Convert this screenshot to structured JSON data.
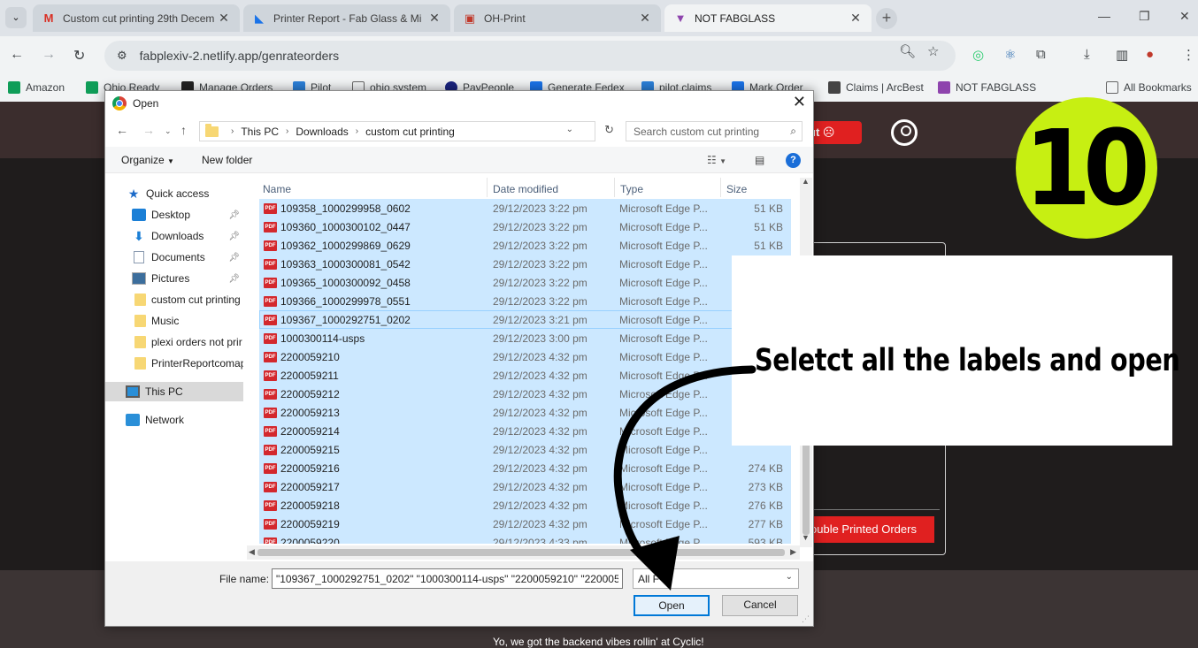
{
  "browser": {
    "tabs": [
      {
        "title": "Custom cut printing 29th Decem",
        "favicon": "gmail-icon",
        "active": false
      },
      {
        "title": "Printer Report - Fab Glass & Mi",
        "favicon": "app-icon",
        "active": false
      },
      {
        "title": "OH-Print",
        "favicon": "page-icon",
        "active": false
      },
      {
        "title": "NOT FABGLASS",
        "favicon": "vite-icon",
        "active": true
      }
    ],
    "url": "fabplexiv-2.netlify.app/genrateorders",
    "bookmarks": [
      {
        "label": "Amazon",
        "icon": "green-plus-icon"
      },
      {
        "label": "Ohio Ready",
        "icon": "green-plus-icon"
      },
      {
        "label": "Manage Orders",
        "icon": "amazon-icon"
      },
      {
        "label": "Pilot",
        "icon": "pilot-icon"
      },
      {
        "label": "ohio system",
        "icon": "page-icon"
      },
      {
        "label": "PayPeople",
        "icon": "paypeople-icon"
      },
      {
        "label": "Generate Fedex",
        "icon": "app-icon"
      },
      {
        "label": "pilot claims",
        "icon": "pilot-icon"
      },
      {
        "label": "Mark Order",
        "icon": "app-icon"
      },
      {
        "label": "Claims | ArcBest",
        "icon": "arcbest-icon"
      },
      {
        "label": "NOT FABGLASS",
        "icon": "vite-icon"
      }
    ],
    "all_bookmarks": "All Bookmarks"
  },
  "page": {
    "logout_fragment": "ut",
    "double_printed_button": "ouble Printed Orders",
    "footer_text": "Yo, we got the backend vibes rollin' at Cyclic!"
  },
  "dialog": {
    "title": "Open",
    "breadcrumb": [
      "This PC",
      "Downloads",
      "custom cut printing"
    ],
    "search_placeholder": "Search custom cut printing",
    "organize_label": "Organize",
    "new_folder_label": "New folder",
    "nav": [
      {
        "label": "Quick access",
        "icon": "star-icon",
        "pinned": false
      },
      {
        "label": "Desktop",
        "icon": "desktop-icon",
        "pinned": true
      },
      {
        "label": "Downloads",
        "icon": "download-icon",
        "pinned": true
      },
      {
        "label": "Documents",
        "icon": "documents-icon",
        "pinned": true
      },
      {
        "label": "Pictures",
        "icon": "pictures-icon",
        "pinned": true
      },
      {
        "label": "custom cut printing",
        "icon": "folder-icon",
        "pinned": false
      },
      {
        "label": "Music",
        "icon": "folder-icon",
        "pinned": false
      },
      {
        "label": "plexi orders not prir",
        "icon": "folder-icon",
        "pinned": false
      },
      {
        "label": "PrinterReportcomap",
        "icon": "folder-icon",
        "pinned": false
      },
      {
        "label": "This PC",
        "icon": "pc-icon",
        "pinned": false
      },
      {
        "label": "Network",
        "icon": "network-icon",
        "pinned": false
      }
    ],
    "columns": {
      "name": "Name",
      "date": "Date modified",
      "type": "Type",
      "size": "Size"
    },
    "files": [
      {
        "name": "109358_1000299958_0602",
        "date": "29/12/2023 3:22 pm",
        "type": "Microsoft Edge P...",
        "size": "51 KB"
      },
      {
        "name": "109360_1000300102_0447",
        "date": "29/12/2023 3:22 pm",
        "type": "Microsoft Edge P...",
        "size": "51 KB"
      },
      {
        "name": "109362_1000299869_0629",
        "date": "29/12/2023 3:22 pm",
        "type": "Microsoft Edge P...",
        "size": "51 KB"
      },
      {
        "name": "109363_1000300081_0542",
        "date": "29/12/2023 3:22 pm",
        "type": "Microsoft Edge P...",
        "size": "51 KB"
      },
      {
        "name": "109365_1000300092_0458",
        "date": "29/12/2023 3:22 pm",
        "type": "Microsoft Edge P...",
        "size": ""
      },
      {
        "name": "109366_1000299978_0551",
        "date": "29/12/2023 3:22 pm",
        "type": "Microsoft Edge P...",
        "size": ""
      },
      {
        "name": "109367_1000292751_0202",
        "date": "29/12/2023 3:21 pm",
        "type": "Microsoft Edge P...",
        "size": ""
      },
      {
        "name": "1000300114-usps",
        "date": "29/12/2023 3:00 pm",
        "type": "Microsoft Edge P...",
        "size": ""
      },
      {
        "name": "2200059210",
        "date": "29/12/2023 4:32 pm",
        "type": "Microsoft Edge P...",
        "size": ""
      },
      {
        "name": "2200059211",
        "date": "29/12/2023 4:32 pm",
        "type": "Microsoft Edge P...",
        "size": ""
      },
      {
        "name": "2200059212",
        "date": "29/12/2023 4:32 pm",
        "type": "Microsoft Edge P...",
        "size": ""
      },
      {
        "name": "2200059213",
        "date": "29/12/2023 4:32 pm",
        "type": "Microsoft Edge P...",
        "size": ""
      },
      {
        "name": "2200059214",
        "date": "29/12/2023 4:32 pm",
        "type": "Microsoft Edge P...",
        "size": ""
      },
      {
        "name": "2200059215",
        "date": "29/12/2023 4:32 pm",
        "type": "Microsoft Edge P...",
        "size": ""
      },
      {
        "name": "2200059216",
        "date": "29/12/2023 4:32 pm",
        "type": "Microsoft Edge P...",
        "size": "274 KB"
      },
      {
        "name": "2200059217",
        "date": "29/12/2023 4:32 pm",
        "type": "Microsoft Edge P...",
        "size": "273 KB"
      },
      {
        "name": "2200059218",
        "date": "29/12/2023 4:32 pm",
        "type": "Microsoft Edge P...",
        "size": "276 KB"
      },
      {
        "name": "2200059219",
        "date": "29/12/2023 4:32 pm",
        "type": "Microsoft Edge P...",
        "size": "277 KB"
      },
      {
        "name": "2200059220",
        "date": "29/12/2023 4:33 pm",
        "type": "Microsoft Edge P...",
        "size": "593 KB"
      }
    ],
    "filename_label": "File name:",
    "filename_value": "\"109367_1000292751_0202\" \"1000300114-usps\" \"2200059210\" \"22000592",
    "filetype_value": "All F",
    "open_button": "Open",
    "cancel_button": "Cancel"
  },
  "overlay": {
    "step_number": "10",
    "instruction": "Seletct all the labels and open",
    "step_color": "#c7ef12"
  }
}
